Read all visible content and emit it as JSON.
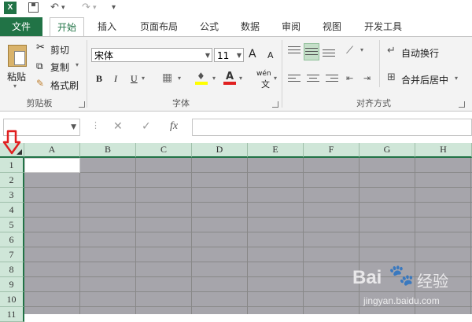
{
  "qat": {
    "excel_logo": "X",
    "undo_icon": "↶",
    "redo_icon": "↷",
    "customize_icon": "▾"
  },
  "tabs": {
    "file": "文件",
    "home": "开始",
    "insert": "插入",
    "page_layout": "页面布局",
    "formulas": "公式",
    "data": "数据",
    "review": "审阅",
    "view": "视图",
    "developer": "开发工具"
  },
  "ribbon": {
    "clipboard": {
      "paste": "粘贴",
      "cut": "剪切",
      "copy": "复制",
      "format_painter": "格式刷",
      "label": "剪贴板"
    },
    "font": {
      "font_name": "宋体",
      "font_size": "11",
      "grow": "A",
      "shrink": "A",
      "bold": "B",
      "italic": "I",
      "underline": "U",
      "phonetic": "wén",
      "label": "字体"
    },
    "alignment": {
      "wrap_text": "自动换行",
      "merge_center": "合并后居中",
      "label": "对齐方式"
    }
  },
  "formula_bar": {
    "name_box": "",
    "cancel": "✕",
    "enter": "✓",
    "fx": "fx",
    "content": ""
  },
  "grid": {
    "columns": [
      "A",
      "B",
      "C",
      "D",
      "E",
      "F",
      "G",
      "H"
    ],
    "rows": [
      "1",
      "2",
      "3",
      "4",
      "5",
      "6",
      "7",
      "8",
      "9",
      "10",
      "11"
    ]
  },
  "watermark": {
    "brand": "Bai",
    "brand2": "经验",
    "url": "jingyan.baidu.com"
  },
  "colors": {
    "accent": "#217346",
    "selection": "#a6a5ab",
    "arrow": "#e02020"
  }
}
